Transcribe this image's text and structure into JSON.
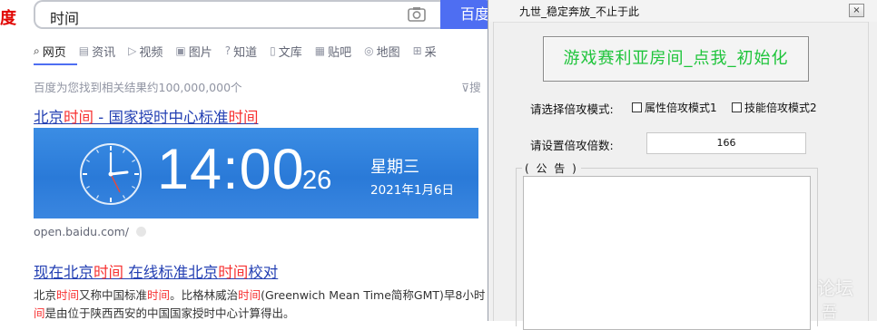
{
  "search": {
    "logo_fragment": "度",
    "query": "时间",
    "button": "百度",
    "tabs": [
      {
        "icon": "search-icon",
        "glyph": "⌕",
        "label": "网页"
      },
      {
        "icon": "news-icon",
        "glyph": "▤",
        "label": "资讯"
      },
      {
        "icon": "video-icon",
        "glyph": "▷",
        "label": "视频"
      },
      {
        "icon": "image-icon",
        "glyph": "▣",
        "label": "图片"
      },
      {
        "icon": "question-icon",
        "glyph": "?",
        "label": "知道"
      },
      {
        "icon": "doc-icon",
        "glyph": "▯",
        "label": "文库"
      },
      {
        "icon": "tieba-icon",
        "glyph": "▦",
        "label": "贴吧"
      },
      {
        "icon": "map-icon",
        "glyph": "◎",
        "label": "地图"
      },
      {
        "icon": "cart-icon",
        "glyph": "⊞",
        "label": "采"
      }
    ],
    "result_count": "百度为您找到相关结果约100,000,000个",
    "filter": "搜"
  },
  "result1": {
    "title_parts": [
      "北京",
      "时间",
      " - 国家授时中心标准",
      "时间"
    ],
    "time_hm": "14:00",
    "time_s": "26",
    "weekday": "星期三",
    "date": "2021年1月6日",
    "url": "open.baidu.com/"
  },
  "result2": {
    "title_parts": [
      "现在北京",
      "时间",
      " 在线标准北京",
      "时间",
      "校对"
    ],
    "snippet1_parts": [
      "北京",
      "时间",
      "又称中国标准",
      "时间",
      "。比格林威治",
      "时间",
      "(Greenwich Mean Time简称GMT)早8小时"
    ],
    "snippet2_parts": [
      "间",
      "是由位于陕西西安的中国国家授时中心计算得出。"
    ]
  },
  "dialog": {
    "title": "九世_稳定奔放_不止于此",
    "close_glyph": "×",
    "init_button": "游戏赛利亚房间_点我_初始化",
    "mode_label": "请选择倍攻模式:",
    "checkbox1": "属性倍攻模式1",
    "checkbox2": "技能倍攻模式2",
    "checkbox1_checked": false,
    "checkbox2_checked": false,
    "multiplier_label": "请设置倍攻倍数:",
    "multiplier_value": "166",
    "notice_legend": "( 公 告 )",
    "notice_text": ""
  },
  "watermark": {
    "line1": "论坛",
    "line2": "吾"
  },
  "colors": {
    "accent": "#4e6ef2",
    "link": "#2440b3",
    "highlight": "#f73131",
    "init_text": "#1ec43a"
  }
}
